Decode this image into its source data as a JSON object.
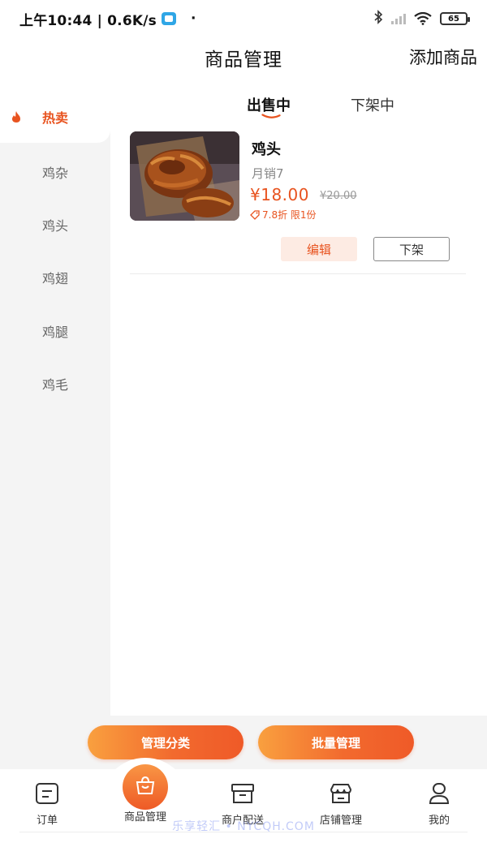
{
  "status_bar": {
    "time_speed": "上午10:44 | 0.6K/s",
    "dot": "·",
    "battery": "65"
  },
  "header": {
    "title": "商品管理",
    "add_label": "添加商品"
  },
  "sidebar": {
    "items": [
      {
        "label": "热卖",
        "active": true
      },
      {
        "label": "鸡杂"
      },
      {
        "label": "鸡头"
      },
      {
        "label": "鸡翅"
      },
      {
        "label": "鸡腿"
      },
      {
        "label": "鸡毛"
      }
    ]
  },
  "tabs": [
    {
      "label": "出售中",
      "active": true
    },
    {
      "label": "下架中"
    }
  ],
  "product": {
    "name": "鸡头",
    "monthly_sales": "月销7",
    "price": "¥18.00",
    "original_price": "¥20.00",
    "discount": "7.8折 限1份",
    "edit_label": "编辑",
    "off_shelf_label": "下架"
  },
  "actions": {
    "manage_category": "管理分类",
    "batch_manage": "批量管理"
  },
  "bottom_nav": [
    {
      "label": "订单",
      "icon": "order-icon"
    },
    {
      "label": "商品管理",
      "icon": "bag-icon",
      "active": true
    },
    {
      "label": "商户配送",
      "icon": "delivery-box-icon"
    },
    {
      "label": "店铺管理",
      "icon": "store-icon"
    },
    {
      "label": "我的",
      "icon": "user-icon"
    }
  ],
  "watermark": "乐享轻汇 • NYCQH.COM",
  "colors": {
    "accent": "#e8531f",
    "sidebar_bg": "#f4f4f4",
    "button_gradient_start": "#f9a03f",
    "button_gradient_end": "#ef5a28"
  }
}
